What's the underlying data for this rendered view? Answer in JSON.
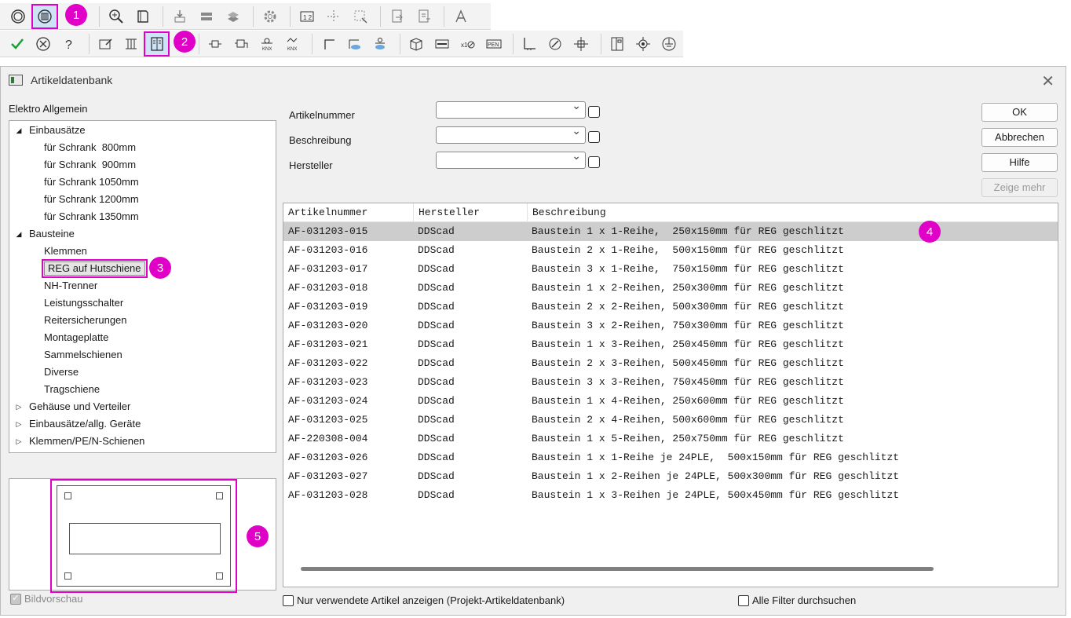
{
  "toolbar1": {
    "buttons": [
      "circle-icon",
      "database-icon",
      "component-tree-icon",
      "zoom-icon",
      "book-icon",
      "insert-icon",
      "stack-icon",
      "layers-icon",
      "gear-icon",
      "numbering-icon",
      "move-icon",
      "transform-icon",
      "export-icon",
      "report-icon",
      "text-icon"
    ]
  },
  "toolbar2": {
    "buttons": [
      "check-icon",
      "cancel-icon",
      "help-icon",
      "edit-sheet-icon",
      "sheet-table-icon",
      "cabinet-icon",
      "connector-icon",
      "terminal-icon",
      "knx-icon",
      "knx-network-icon",
      "corner-icon",
      "fill-icon",
      "cut-icon",
      "box-icon",
      "rail-icon",
      "multiply-icon",
      "pen-icon",
      "axis-icon",
      "measure-icon",
      "crosshair-icon",
      "panel-icon",
      "target-icon",
      "ground-icon"
    ]
  },
  "badges": [
    "1",
    "2",
    "3",
    "4",
    "5"
  ],
  "dialog": {
    "title": "Artikeldatenbank",
    "close": "✕",
    "category_label": "Elektro Allgemein",
    "tree": [
      {
        "label": "Einbausätze",
        "level": 0,
        "state": "expanded"
      },
      {
        "label": "für Schrank  800mm",
        "level": 1
      },
      {
        "label": "für Schrank  900mm",
        "level": 1
      },
      {
        "label": "für Schrank 1050mm",
        "level": 1
      },
      {
        "label": "für Schrank 1200mm",
        "level": 1
      },
      {
        "label": "für Schrank 1350mm",
        "level": 1
      },
      {
        "label": "Bausteine",
        "level": 0,
        "state": "expanded"
      },
      {
        "label": "Klemmen",
        "level": 1
      },
      {
        "label": "REG auf Hutschiene",
        "level": 1,
        "selected": true
      },
      {
        "label": "NH-Trenner",
        "level": 1
      },
      {
        "label": "Leistungsschalter",
        "level": 1
      },
      {
        "label": "Reitersicherungen",
        "level": 1
      },
      {
        "label": "Montageplatte",
        "level": 1
      },
      {
        "label": "Sammelschienen",
        "level": 1
      },
      {
        "label": "Diverse",
        "level": 1
      },
      {
        "label": "Tragschiene",
        "level": 1
      },
      {
        "label": "Gehäuse und Verteiler",
        "level": 0,
        "state": "collapsed"
      },
      {
        "label": "Einbausätze/allg. Geräte",
        "level": 0,
        "state": "collapsed"
      },
      {
        "label": "Klemmen/PE/N-Schienen",
        "level": 0,
        "state": "collapsed"
      }
    ],
    "preview_checkbox": "Bildvorschau",
    "filters": {
      "artikelnummer": {
        "label": "Artikelnummer",
        "value": ""
      },
      "beschreibung": {
        "label": "Beschreibung",
        "value": ""
      },
      "hersteller": {
        "label": "Hersteller",
        "value": ""
      }
    },
    "buttons": {
      "ok": "OK",
      "abbrechen": "Abbrechen",
      "hilfe": "Hilfe",
      "zeige_mehr": "Zeige mehr"
    },
    "table": {
      "headers": [
        "Artikelnummer",
        "Hersteller",
        "Beschreibung"
      ],
      "rows": [
        [
          "AF-031203-015",
          "DDScad",
          "Baustein 1 x 1-Reihe,  250x150mm für REG geschlitzt"
        ],
        [
          "AF-031203-016",
          "DDScad",
          "Baustein 2 x 1-Reihe,  500x150mm für REG geschlitzt"
        ],
        [
          "AF-031203-017",
          "DDScad",
          "Baustein 3 x 1-Reihe,  750x150mm für REG geschlitzt"
        ],
        [
          "AF-031203-018",
          "DDScad",
          "Baustein 1 x 2-Reihen, 250x300mm für REG geschlitzt"
        ],
        [
          "AF-031203-019",
          "DDScad",
          "Baustein 2 x 2-Reihen, 500x300mm für REG geschlitzt"
        ],
        [
          "AF-031203-020",
          "DDScad",
          "Baustein 3 x 2-Reihen, 750x300mm für REG geschlitzt"
        ],
        [
          "AF-031203-021",
          "DDScad",
          "Baustein 1 x 3-Reihen, 250x450mm für REG geschlitzt"
        ],
        [
          "AF-031203-022",
          "DDScad",
          "Baustein 2 x 3-Reihen, 500x450mm für REG geschlitzt"
        ],
        [
          "AF-031203-023",
          "DDScad",
          "Baustein 3 x 3-Reihen, 750x450mm für REG geschlitzt"
        ],
        [
          "AF-031203-024",
          "DDScad",
          "Baustein 1 x 4-Reihen, 250x600mm für REG geschlitzt"
        ],
        [
          "AF-031203-025",
          "DDScad",
          "Baustein 2 x 4-Reihen, 500x600mm für REG geschlitzt"
        ],
        [
          "AF-220308-004",
          "DDScad",
          "Baustein 1 x 5-Reihen, 250x750mm für REG geschlitzt"
        ],
        [
          "AF-031203-026",
          "DDScad",
          "Baustein 1 x 1-Reihe je 24PLE,  500x150mm für REG geschlitzt"
        ],
        [
          "AF-031203-027",
          "DDScad",
          "Baustein 1 x 2-Reihen je 24PLE, 500x300mm für REG geschlitzt"
        ],
        [
          "AF-031203-028",
          "DDScad",
          "Baustein 1 x 3-Reihen je 24PLE, 500x450mm für REG geschlitzt"
        ]
      ],
      "selected_row": 0
    },
    "checkbox_used_only": "Nur verwendete Artikel anzeigen (Projekt-Artikeldatenbank)",
    "checkbox_all_filters": "Alle Filter durchsuchen"
  },
  "colors": {
    "highlight": "#e000c8",
    "selection": "#cdcdcd",
    "check_green": "#1a9e3a"
  }
}
